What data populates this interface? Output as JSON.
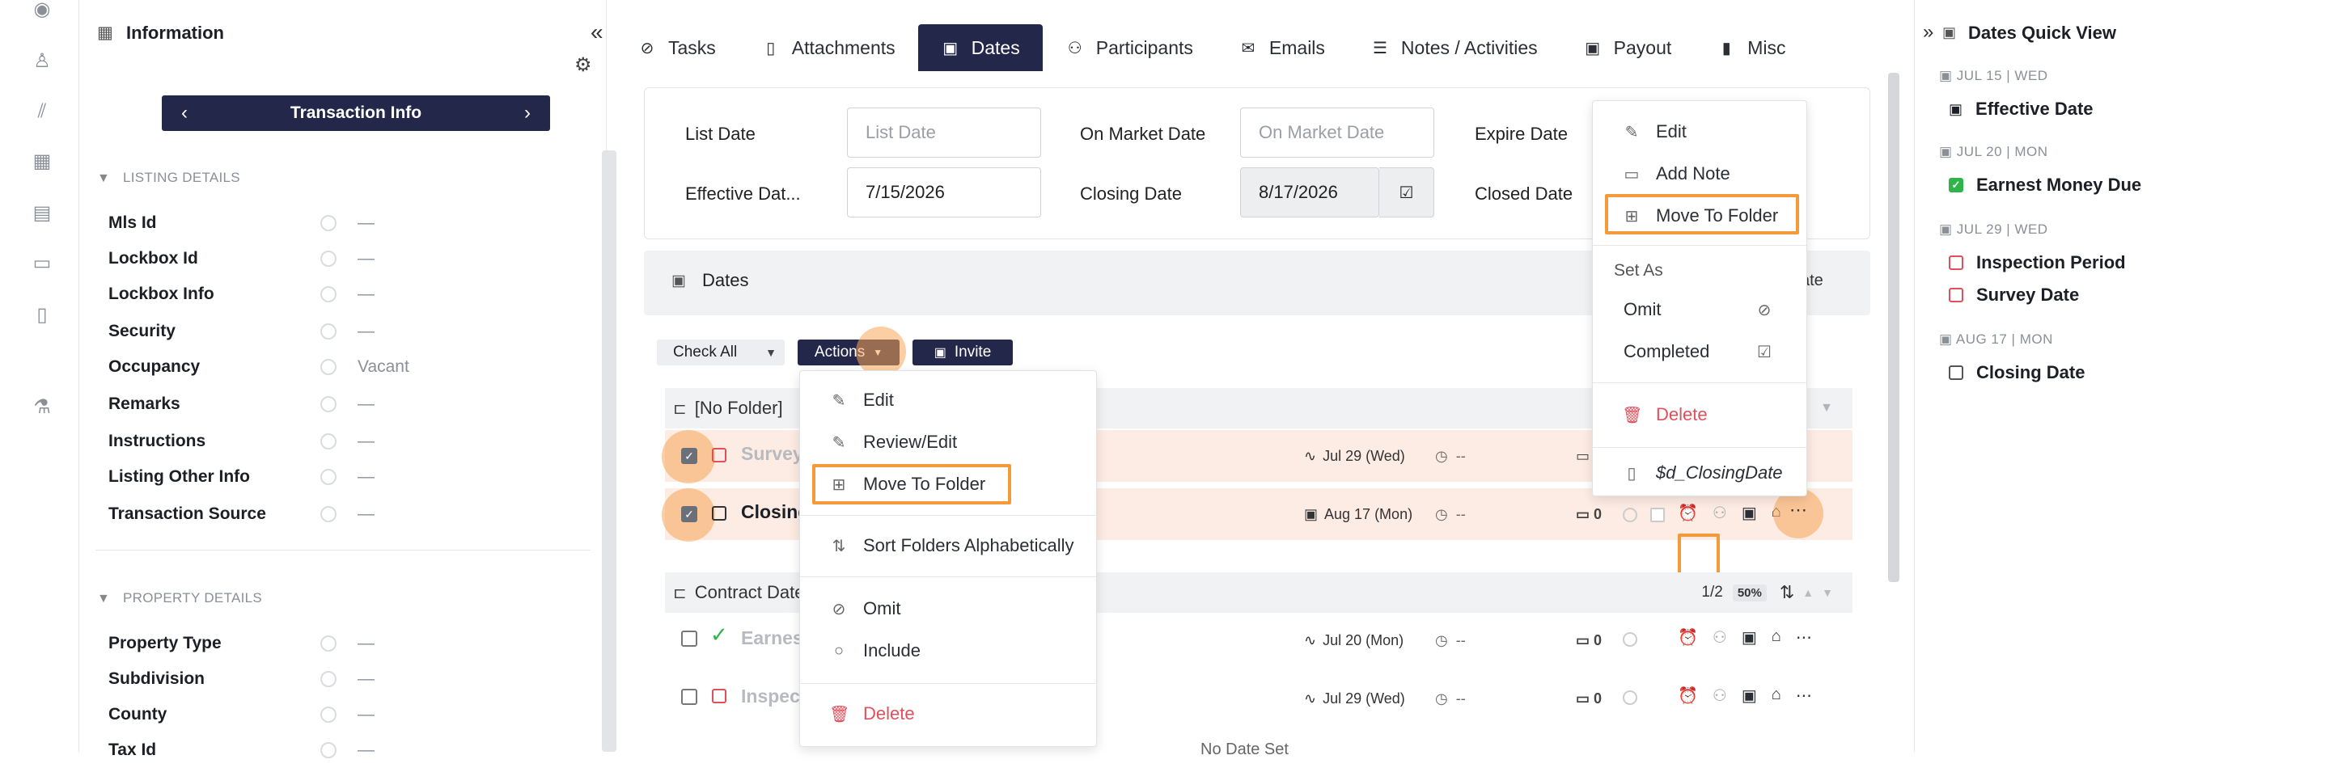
{
  "left": {
    "title": "Information",
    "nav_label": "Transaction Info",
    "listing_section": "LISTING DETAILS",
    "listing_fields": [
      {
        "name": "Mls Id",
        "value": "—"
      },
      {
        "name": "Lockbox Id",
        "value": "—"
      },
      {
        "name": "Lockbox Info",
        "value": "—"
      },
      {
        "name": "Security",
        "value": "—"
      },
      {
        "name": "Occupancy",
        "value": "Vacant"
      },
      {
        "name": "Remarks",
        "value": "—"
      },
      {
        "name": "Instructions",
        "value": "—"
      },
      {
        "name": "Listing Other Info",
        "value": "—"
      },
      {
        "name": "Transaction Source",
        "value": "—"
      }
    ],
    "property_section": "PROPERTY DETAILS",
    "property_fields": [
      {
        "name": "Property Type",
        "value": "—"
      },
      {
        "name": "Subdivision",
        "value": "—"
      },
      {
        "name": "County",
        "value": "—"
      },
      {
        "name": "Tax Id",
        "value": "—"
      }
    ]
  },
  "tabs": [
    "Tasks",
    "Attachments",
    "Dates",
    "Participants",
    "Emails",
    "Notes / Activities",
    "Payout",
    "Misc"
  ],
  "date_fields": {
    "list_date_label": "List Date",
    "list_date_placeholder": "List Date",
    "on_market_label": "On Market Date",
    "on_market_placeholder": "On Market Date",
    "expire_label": "Expire Date",
    "effective_label": "Effective Dat...",
    "effective_value": "7/15/2026",
    "closing_label": "Closing Date",
    "closing_value": "8/17/2026",
    "closed_label": "Closed Date"
  },
  "dates_section": {
    "title": "Dates",
    "right_label": "ate",
    "check_all": "Check All",
    "actions": "Actions",
    "invite": "Invite"
  },
  "folders": {
    "no_folder": "[No Folder]",
    "contract": "Contract Date",
    "pager": "1/2",
    "percent": "50%"
  },
  "rows": [
    {
      "name": "Survey",
      "date": "Jul 29 (Wed)",
      "dash": "--",
      "count": ""
    },
    {
      "name": "Closing",
      "date": "Aug 17 (Mon)",
      "dash": "--",
      "count": "0"
    },
    {
      "name": "Earnes",
      "date": "Jul 20 (Mon)",
      "dash": "--",
      "count": "0"
    },
    {
      "name": "Inspec",
      "date": "Jul 29 (Wed)",
      "dash": "--",
      "count": "0"
    }
  ],
  "no_date_set": "No Date Set",
  "actions_menu": {
    "edit": "Edit",
    "review_edit": "Review/Edit",
    "move_to_folder": "Move To Folder",
    "sort_folders": "Sort Folders Alphabetically",
    "omit": "Omit",
    "include": "Include",
    "delete": "Delete"
  },
  "row_menu": {
    "edit": "Edit",
    "add_note": "Add Note",
    "move_to_folder": "Move To Folder",
    "set_as": "Set As",
    "omit": "Omit",
    "completed": "Completed",
    "delete": "Delete",
    "variable": "$d_ClosingDate"
  },
  "quick_view": {
    "title": "Dates Quick View",
    "groups": [
      {
        "date": "JUL 15 | WED",
        "items": [
          {
            "label": "Effective Date"
          }
        ]
      },
      {
        "date": "JUL 20 | MON",
        "items": [
          {
            "label": "Earnest Money Due"
          }
        ]
      },
      {
        "date": "JUL 29 | WED",
        "items": [
          {
            "label": "Inspection Period"
          },
          {
            "label": "Survey Date"
          }
        ]
      },
      {
        "date": "AUG 17 | MON",
        "items": [
          {
            "label": "Closing Date"
          }
        ]
      }
    ]
  },
  "colors": {
    "navy": "#23274a",
    "highlight": "#f39a3a",
    "danger": "#e0505a",
    "success": "#2fb44a"
  }
}
